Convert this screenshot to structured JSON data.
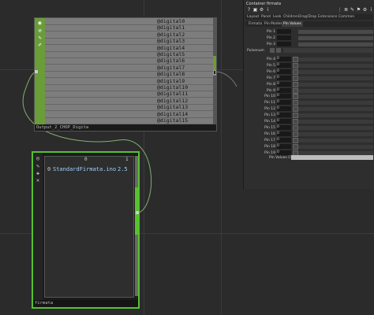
{
  "node_top": {
    "rows": [
      "@digital0",
      "@digital1",
      "@digital2",
      "@digital3",
      "@digital4",
      "@digital5",
      "@digital6",
      "@digital7",
      "@digital8",
      "@digital9",
      "@digital10",
      "@digital11",
      "@digital12",
      "@digital13",
      "@digital14",
      "@digital15"
    ],
    "footer": "Output_2_CHOP_Digita"
  },
  "node_firmata": {
    "col_headers": [
      "0",
      "1"
    ],
    "row_value": "StandardFirmata.ino",
    "row_version": "2.5",
    "row_index": "0",
    "footer": "firmata"
  },
  "panel": {
    "title": "Container  firmata",
    "tabs": [
      "Layout",
      "Panel",
      "Look",
      "Children",
      "Drag/Drop",
      "Extensions",
      "Common"
    ],
    "tabs2": [
      "Firmata",
      "Pin Modes",
      "Pin Values"
    ],
    "active_tab2": "Pin Values",
    "pulse_label": "Pulsenum",
    "pins": [
      {
        "label": "Pin 4",
        "value": "0"
      },
      {
        "label": "Pin 5",
        "value": "0"
      },
      {
        "label": "Pin 6",
        "value": "0"
      },
      {
        "label": "Pin 7",
        "value": "0"
      },
      {
        "label": "Pin 8",
        "value": "0"
      },
      {
        "label": "Pin 9",
        "value": "0"
      },
      {
        "label": "Pin 10",
        "value": "0"
      },
      {
        "label": "Pin 11",
        "value": "0"
      },
      {
        "label": "Pin 12",
        "value": "0"
      },
      {
        "label": "Pin 13",
        "value": "0"
      },
      {
        "label": "Pin 14",
        "value": "0"
      },
      {
        "label": "Pin 15",
        "value": "0"
      },
      {
        "label": "Pin 16",
        "value": "0"
      },
      {
        "label": "Pin 17",
        "value": "0"
      },
      {
        "label": "Pin 18",
        "value": "0"
      },
      {
        "label": "Pin 19",
        "value": "0"
      }
    ],
    "top_pins": [
      {
        "label": "Pin 1"
      },
      {
        "label": "Pin 2"
      },
      {
        "label": "Pin 3"
      }
    ],
    "chop_label": "Pin Values CHOP"
  },
  "colors": {
    "accent": "#55c22e",
    "node_green": "#6a9c3a",
    "background": "#2b2b2b"
  }
}
